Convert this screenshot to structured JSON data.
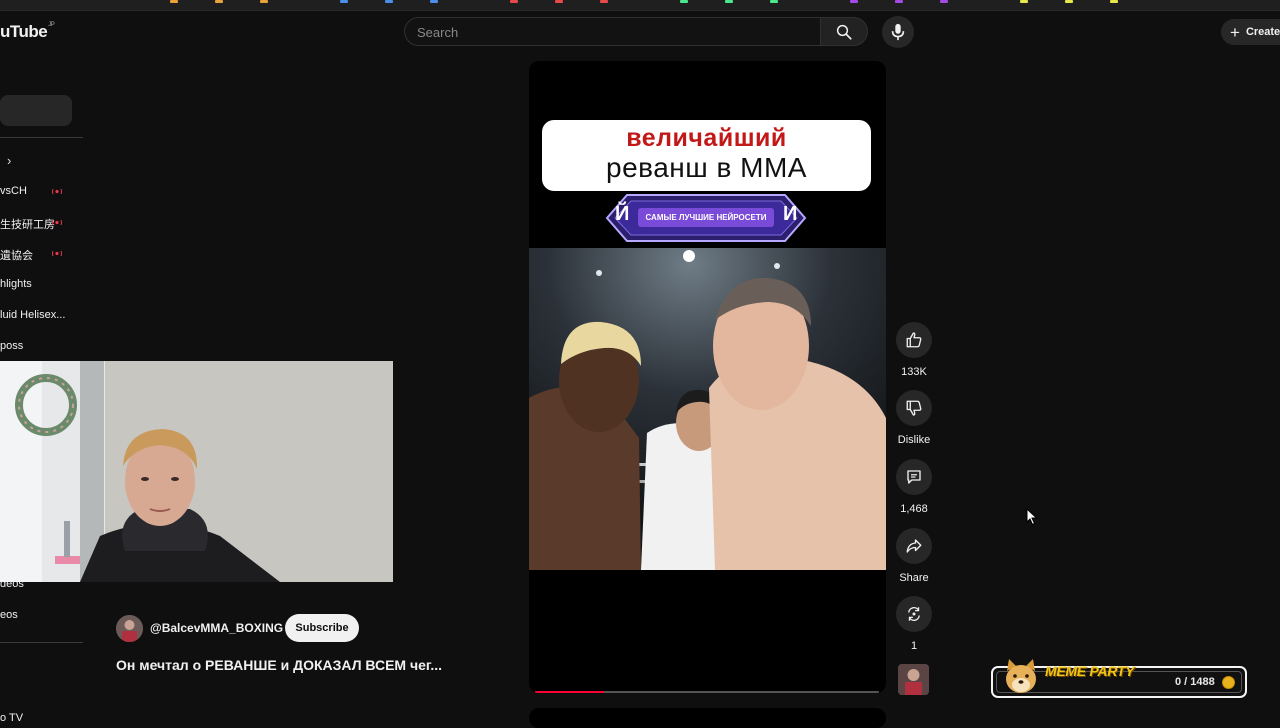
{
  "browser": {
    "bookmark_colors": [
      "#e8a33c",
      "#4a8fe8",
      "#e84a4a",
      "#4ae88a",
      "#a34ae8",
      "#e8e84a"
    ]
  },
  "header": {
    "logo_text": "uTube",
    "logo_region": "JP",
    "search_placeholder": "Search",
    "create_label": "Create"
  },
  "sidebar": {
    "items": [
      {
        "label": "vsCH",
        "live": true
      },
      {
        "label": "生技研工房",
        "live": true
      },
      {
        "label": "遺協会",
        "live": true
      },
      {
        "label": "hlights",
        "live": false
      },
      {
        "label": "luid Helisex...",
        "live": false
      },
      {
        "label": "poss",
        "live": false
      }
    ],
    "bottom_items": [
      {
        "label": "deos"
      },
      {
        "label": "eos"
      },
      {
        "label": "o TV"
      }
    ]
  },
  "short": {
    "caption_line1": "величайший",
    "caption_line2": "реванш в ММА",
    "badge_text": "САМЫЕ ЛУЧШИЕ НЕЙРОСЕТИ",
    "badge_left_letter": "Й",
    "badge_right_letter": "И",
    "progress": 0.2,
    "channel": "@BalcevMMA_BOXING",
    "subscribe_label": "Subscribe",
    "title": "Он мечтал о РЕВАНШЕ и ДОКАЗАЛ ВСЕМ чег..."
  },
  "actions": {
    "like_count": "133K",
    "dislike_label": "Dislike",
    "comment_count": "1,468",
    "share_label": "Share",
    "remix_count": "1"
  },
  "overlay": {
    "meme_title": "MEME PARTY",
    "meme_count": "0 / 1488",
    "accent": "#f3c315"
  }
}
